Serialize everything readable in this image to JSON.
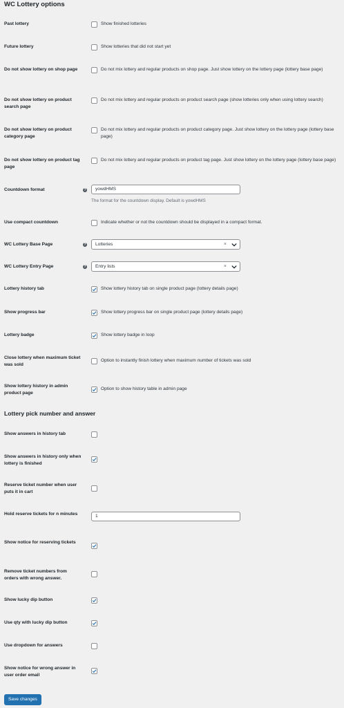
{
  "section1": {
    "title": "WC Lottery options",
    "rows": [
      {
        "label": "Past lottery",
        "desc": "Show finished lotteries",
        "checked": false
      },
      {
        "label": "Future lottery",
        "desc": "Show lotteries that did not start yet",
        "checked": false
      },
      {
        "label": "Do not show lottery on shop page",
        "desc": "Do not mix lottery and regular products on shop page. Just show lottery on the lottery page (lottery base page)",
        "checked": false
      },
      {
        "label": "Do not show lottery on product search page",
        "desc": "Do not mix lottery and regular products on product search page (show lotteries only when using lottery search)",
        "checked": false
      },
      {
        "label": "Do not show lottery on product category page",
        "desc": "Do not mix lottery and regular products on product category page. Just show lottery on the lottery page (lottery base page)",
        "checked": false
      },
      {
        "label": "Do not show lottery on product tag page",
        "desc": "Do not mix lottery and regular products on product tag page. Just show lottery on the lottery page (lottery base page)",
        "checked": false
      }
    ],
    "countdown": {
      "label": "Countdown format",
      "value": "yowdHMS",
      "help": "The format for the countdown display. Default is yowdHMS"
    },
    "compact": {
      "label": "Use compact countdown",
      "desc": "Indicate whether or not the countdown should be displayed in a compact format.",
      "checked": false
    },
    "base_page": {
      "label": "WC Lottery Base Page",
      "value": "Lotteries"
    },
    "entry_page": {
      "label": "WC Lottery Entry Page",
      "value": "Entry lists"
    },
    "rows2": [
      {
        "label": "Lottery history tab",
        "desc": "Show lottery history tab on single product page (lottery details page)",
        "checked": true
      },
      {
        "label": "Show progress bar",
        "desc": "Show lottery progress bar on single product page (lottery details page)",
        "checked": true
      },
      {
        "label": "Lottery badge",
        "desc": "Show lottery badge in loop",
        "checked": true
      },
      {
        "label": "Close lottery when maximum ticket was sold",
        "desc": "Option to instantly finish lottery when maximum number of tickets was sold",
        "checked": false
      },
      {
        "label": "Show lottery history in admin product page",
        "desc": "Option to show history table in admin page",
        "checked": true
      }
    ]
  },
  "section2": {
    "title": "Lottery pick number and answer",
    "rows_a": [
      {
        "label": "Show answers in history tab",
        "checked": false
      },
      {
        "label": "Show answers in history only when lottery is finished",
        "checked": true
      },
      {
        "label": "Reserve ticket number when user puts it in cart",
        "checked": false
      }
    ],
    "hold": {
      "label": "Hold reserve tickets for n minutes",
      "value": "1"
    },
    "rows_b": [
      {
        "label": "Show notice for reserving tickets",
        "checked": true
      },
      {
        "label": "Remove ticket numbers from orders with wrong answer.",
        "checked": false
      },
      {
        "label": "Show lucky dip button",
        "checked": true
      },
      {
        "label": "Use qty with lucky dip button",
        "checked": true
      },
      {
        "label": "Use dropdown for answers",
        "checked": false
      },
      {
        "label": "Show notice for wrong answer in user order email",
        "checked": true
      }
    ]
  },
  "save_label": "Save changes",
  "colors": {
    "primary": "#2271b1",
    "background": "#f0f0f1",
    "text": "#1d2327"
  }
}
